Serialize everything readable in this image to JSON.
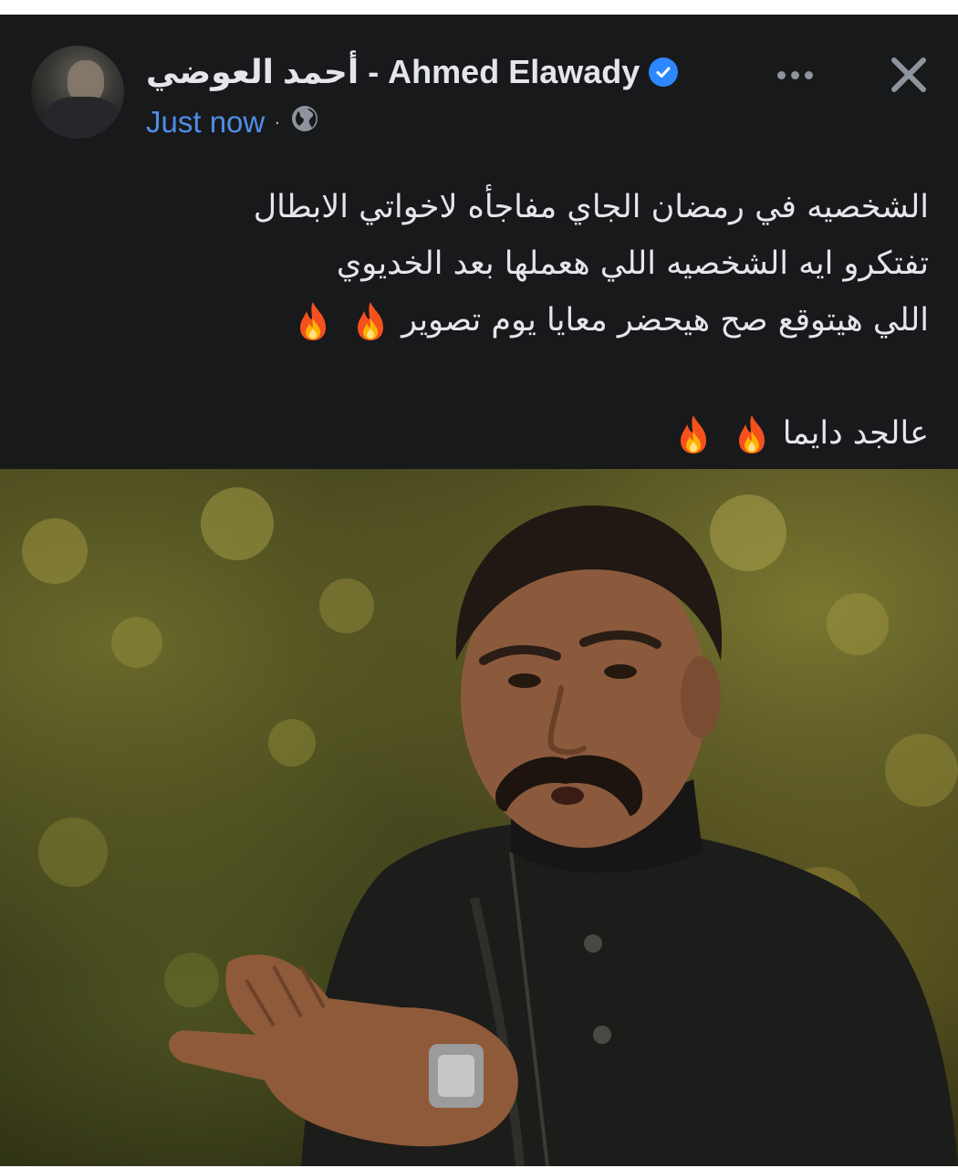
{
  "post": {
    "author_name": "أحمد العوضي - Ahmed Elawady",
    "verified": true,
    "timestamp": "Just now",
    "privacy_icon": "globe-icon",
    "more_icon": "more-options-icon",
    "close_icon": "close-icon",
    "text_lines": [
      "الشخصيه في رمضان الجاي مفاجأه لاخواتي الابطال",
      "تفتكرو  ايه الشخصيه اللي هعملها بعد الخديوي",
      "اللي هيتوقع صح هيحضر معايا يوم تصوير"
    ],
    "closing_line": "عالجد دايما",
    "emoji": "fire-emoji",
    "photo_alt": "post-photo"
  },
  "colors": {
    "background": "#18191a",
    "text": "#e4e6eb",
    "link": "#4f8de8",
    "verified": "#2d88ff",
    "icon_gray": "#8d949e"
  }
}
